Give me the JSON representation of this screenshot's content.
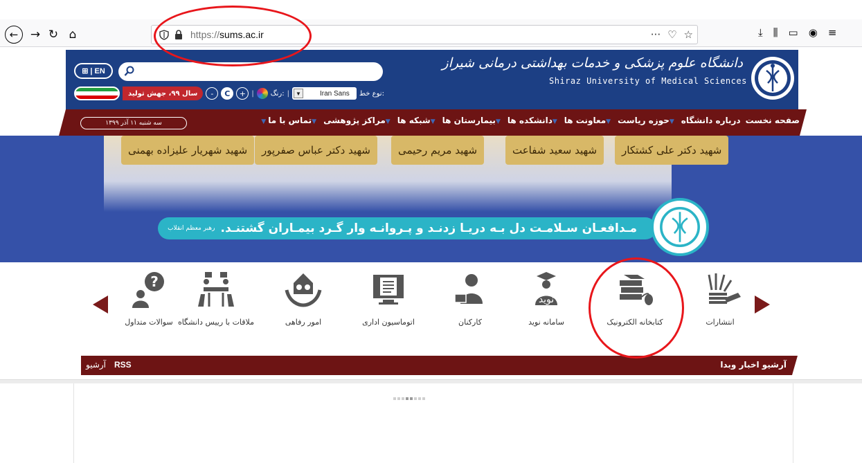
{
  "browser": {
    "url_host": "https://sums.ac.ir",
    "url_prefix": "https://",
    "url_domain": "sums.ac.ir",
    "page_actions": [
      "···",
      "pocket-icon",
      "bookmark-star-icon"
    ],
    "toolbar": [
      "download-icon",
      "library-icon",
      "sidebar-icon",
      "account-icon",
      "menu-icon"
    ]
  },
  "header": {
    "lang_label": "EN",
    "search_placeholder": "",
    "year_slogan": "سال ۹۹، جهش تولید",
    "font_type_label": "نوع خط:",
    "font_name": "Iran Sans",
    "color_label": "رنگ:",
    "logo_fa": "دانشگاه علوم پزشکی و خدمات بهداشتی درمانی شیراز",
    "logo_en": "Shiraz University of Medical Sciences"
  },
  "menu": {
    "items": [
      "صفحه نخست",
      "درباره دانشگاه",
      "حوزه ریاست",
      "معاونت ها",
      "دانشکده ها",
      "بیمارستان ها",
      "شبکه ها",
      "مراکز پژوهشی",
      "تماس با ما"
    ],
    "date": "سه شنبه ۱۱ آذر ۱۳۹۹"
  },
  "banner": {
    "martyrs": [
      "شهید شهریار علیزاده بهمنی",
      "شهید دکتر عباس صفرپور",
      "شهید مریم رحیمی",
      "شهید سعید شفاعت",
      "شهید دکتر علی کشتکار"
    ],
    "slogan": "مـدافعـان سـلامـت دل بـه دریـا زدنـد و پـروانـه وار گـرد بیمـاران گشتنـد.",
    "slogan_source": "رهبر معظم انقلاب"
  },
  "quick_links": [
    {
      "label": "انتشارات",
      "icon": "publications-icon"
    },
    {
      "label": "کتابخانه الکترونیک",
      "icon": "e-library-icon"
    },
    {
      "label": "سامانه نوید",
      "icon": "navid-system-icon"
    },
    {
      "label": "کارکنان",
      "icon": "staff-icon"
    },
    {
      "label": "اتوماسیون اداری",
      "icon": "office-automation-icon"
    },
    {
      "label": "امور رفاهی",
      "icon": "welfare-icon"
    },
    {
      "label": "ملاقات با رییس دانشگاه",
      "icon": "meeting-chancellor-icon"
    },
    {
      "label": "سوالات متداول",
      "icon": "faq-icon"
    }
  ],
  "news": {
    "title": "آرشیو اخبار وبدا",
    "rss": "RSS",
    "archive": "آرشیو"
  },
  "colors": {
    "header_blue": "#1c3f84",
    "menu_maroon": "#6d1414",
    "banner_blue": "#3551a8",
    "slogan_teal": "#2bb4c7",
    "annotation_red": "#e8161b"
  }
}
